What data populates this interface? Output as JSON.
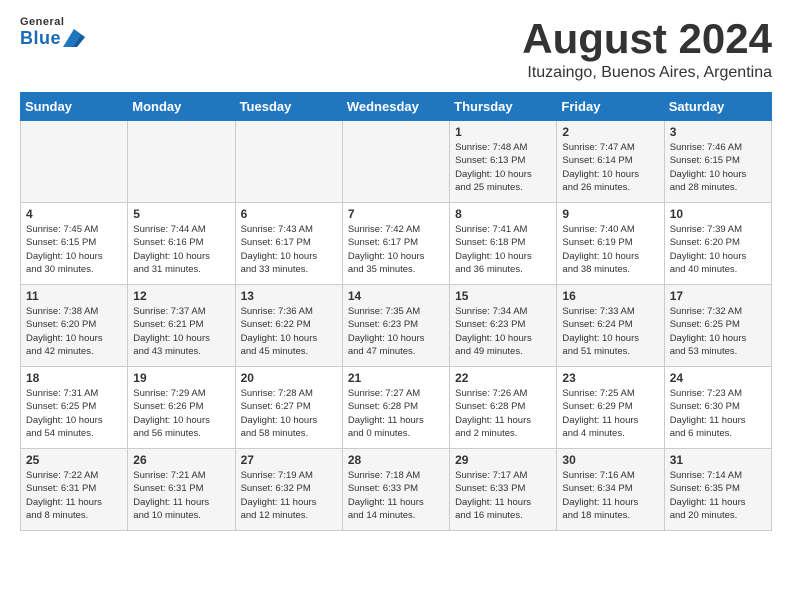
{
  "logo": {
    "general": "General",
    "blue": "Blue"
  },
  "title": "August 2024",
  "subtitle": "Ituzaingo, Buenos Aires, Argentina",
  "days_of_week": [
    "Sunday",
    "Monday",
    "Tuesday",
    "Wednesday",
    "Thursday",
    "Friday",
    "Saturday"
  ],
  "weeks": [
    [
      {
        "day": "",
        "info": ""
      },
      {
        "day": "",
        "info": ""
      },
      {
        "day": "",
        "info": ""
      },
      {
        "day": "",
        "info": ""
      },
      {
        "day": "1",
        "info": "Sunrise: 7:48 AM\nSunset: 6:13 PM\nDaylight: 10 hours\nand 25 minutes."
      },
      {
        "day": "2",
        "info": "Sunrise: 7:47 AM\nSunset: 6:14 PM\nDaylight: 10 hours\nand 26 minutes."
      },
      {
        "day": "3",
        "info": "Sunrise: 7:46 AM\nSunset: 6:15 PM\nDaylight: 10 hours\nand 28 minutes."
      }
    ],
    [
      {
        "day": "4",
        "info": "Sunrise: 7:45 AM\nSunset: 6:15 PM\nDaylight: 10 hours\nand 30 minutes."
      },
      {
        "day": "5",
        "info": "Sunrise: 7:44 AM\nSunset: 6:16 PM\nDaylight: 10 hours\nand 31 minutes."
      },
      {
        "day": "6",
        "info": "Sunrise: 7:43 AM\nSunset: 6:17 PM\nDaylight: 10 hours\nand 33 minutes."
      },
      {
        "day": "7",
        "info": "Sunrise: 7:42 AM\nSunset: 6:17 PM\nDaylight: 10 hours\nand 35 minutes."
      },
      {
        "day": "8",
        "info": "Sunrise: 7:41 AM\nSunset: 6:18 PM\nDaylight: 10 hours\nand 36 minutes."
      },
      {
        "day": "9",
        "info": "Sunrise: 7:40 AM\nSunset: 6:19 PM\nDaylight: 10 hours\nand 38 minutes."
      },
      {
        "day": "10",
        "info": "Sunrise: 7:39 AM\nSunset: 6:20 PM\nDaylight: 10 hours\nand 40 minutes."
      }
    ],
    [
      {
        "day": "11",
        "info": "Sunrise: 7:38 AM\nSunset: 6:20 PM\nDaylight: 10 hours\nand 42 minutes."
      },
      {
        "day": "12",
        "info": "Sunrise: 7:37 AM\nSunset: 6:21 PM\nDaylight: 10 hours\nand 43 minutes."
      },
      {
        "day": "13",
        "info": "Sunrise: 7:36 AM\nSunset: 6:22 PM\nDaylight: 10 hours\nand 45 minutes."
      },
      {
        "day": "14",
        "info": "Sunrise: 7:35 AM\nSunset: 6:23 PM\nDaylight: 10 hours\nand 47 minutes."
      },
      {
        "day": "15",
        "info": "Sunrise: 7:34 AM\nSunset: 6:23 PM\nDaylight: 10 hours\nand 49 minutes."
      },
      {
        "day": "16",
        "info": "Sunrise: 7:33 AM\nSunset: 6:24 PM\nDaylight: 10 hours\nand 51 minutes."
      },
      {
        "day": "17",
        "info": "Sunrise: 7:32 AM\nSunset: 6:25 PM\nDaylight: 10 hours\nand 53 minutes."
      }
    ],
    [
      {
        "day": "18",
        "info": "Sunrise: 7:31 AM\nSunset: 6:25 PM\nDaylight: 10 hours\nand 54 minutes."
      },
      {
        "day": "19",
        "info": "Sunrise: 7:29 AM\nSunset: 6:26 PM\nDaylight: 10 hours\nand 56 minutes."
      },
      {
        "day": "20",
        "info": "Sunrise: 7:28 AM\nSunset: 6:27 PM\nDaylight: 10 hours\nand 58 minutes."
      },
      {
        "day": "21",
        "info": "Sunrise: 7:27 AM\nSunset: 6:28 PM\nDaylight: 11 hours\nand 0 minutes."
      },
      {
        "day": "22",
        "info": "Sunrise: 7:26 AM\nSunset: 6:28 PM\nDaylight: 11 hours\nand 2 minutes."
      },
      {
        "day": "23",
        "info": "Sunrise: 7:25 AM\nSunset: 6:29 PM\nDaylight: 11 hours\nand 4 minutes."
      },
      {
        "day": "24",
        "info": "Sunrise: 7:23 AM\nSunset: 6:30 PM\nDaylight: 11 hours\nand 6 minutes."
      }
    ],
    [
      {
        "day": "25",
        "info": "Sunrise: 7:22 AM\nSunset: 6:31 PM\nDaylight: 11 hours\nand 8 minutes."
      },
      {
        "day": "26",
        "info": "Sunrise: 7:21 AM\nSunset: 6:31 PM\nDaylight: 11 hours\nand 10 minutes."
      },
      {
        "day": "27",
        "info": "Sunrise: 7:19 AM\nSunset: 6:32 PM\nDaylight: 11 hours\nand 12 minutes."
      },
      {
        "day": "28",
        "info": "Sunrise: 7:18 AM\nSunset: 6:33 PM\nDaylight: 11 hours\nand 14 minutes."
      },
      {
        "day": "29",
        "info": "Sunrise: 7:17 AM\nSunset: 6:33 PM\nDaylight: 11 hours\nand 16 minutes."
      },
      {
        "day": "30",
        "info": "Sunrise: 7:16 AM\nSunset: 6:34 PM\nDaylight: 11 hours\nand 18 minutes."
      },
      {
        "day": "31",
        "info": "Sunrise: 7:14 AM\nSunset: 6:35 PM\nDaylight: 11 hours\nand 20 minutes."
      }
    ]
  ]
}
